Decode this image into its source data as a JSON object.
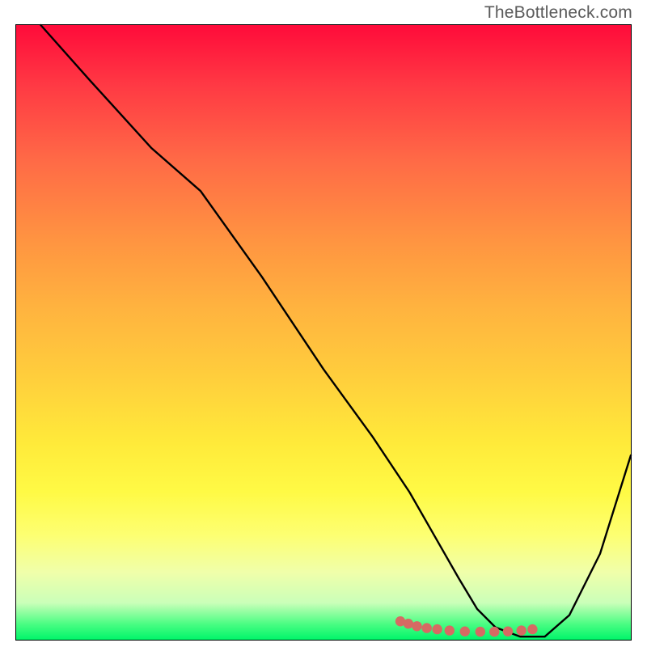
{
  "watermark": "TheBottleneck.com",
  "chart_data": {
    "type": "line",
    "title": "",
    "xlabel": "",
    "ylabel": "",
    "xlim": [
      0,
      100
    ],
    "ylim": [
      0,
      100
    ],
    "grid": false,
    "legend": false,
    "series": [
      {
        "name": "curve",
        "x": [
          4,
          12,
          22,
          30,
          40,
          50,
          58,
          64,
          68,
          72,
          75,
          78,
          82,
          86,
          90,
          95,
          100
        ],
        "y": [
          100,
          91,
          80,
          73,
          59,
          44,
          33,
          24,
          17,
          10,
          5,
          2,
          0.5,
          0.5,
          4,
          14,
          30
        ]
      }
    ],
    "markers": {
      "name": "dots",
      "color": "#d66a63",
      "points_x": [
        62.5,
        63.8,
        65.2,
        66.8,
        68.5,
        70.5,
        73.0,
        75.5,
        77.8,
        80.0,
        82.2,
        84.0
      ],
      "points_y": [
        3.0,
        2.6,
        2.2,
        1.9,
        1.7,
        1.5,
        1.35,
        1.3,
        1.3,
        1.35,
        1.5,
        1.7
      ]
    },
    "colors": {
      "gradient_top": "#ff0b3a",
      "gradient_mid": "#ffd63c",
      "gradient_bottom": "#00f56a",
      "curve": "#000000",
      "marker": "#d66a63"
    }
  }
}
